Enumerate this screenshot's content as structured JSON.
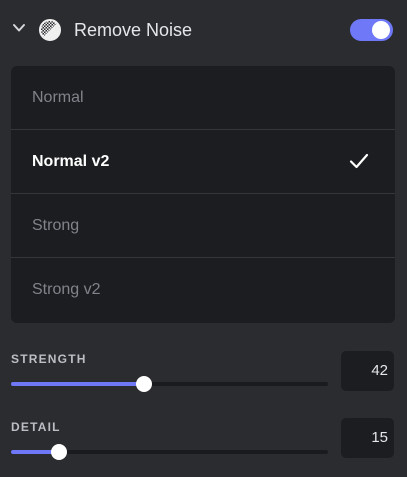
{
  "header": {
    "title": "Remove Noise",
    "expanded": true,
    "enabled": true,
    "icons": {
      "chevron": "chevron-down-icon",
      "noise": "noise-icon"
    }
  },
  "colors": {
    "accent": "#6f78f6",
    "background": "#2b2c30",
    "card": "#1c1d21"
  },
  "options": [
    {
      "label": "Normal",
      "selected": false
    },
    {
      "label": "Normal v2",
      "selected": true
    },
    {
      "label": "Strong",
      "selected": false
    },
    {
      "label": "Strong v2",
      "selected": false
    }
  ],
  "sliders": {
    "strength": {
      "label": "STRENGTH",
      "value": "42",
      "level": 0.42
    },
    "detail": {
      "label": "DETAIL",
      "value": "15",
      "level": 0.15
    }
  }
}
